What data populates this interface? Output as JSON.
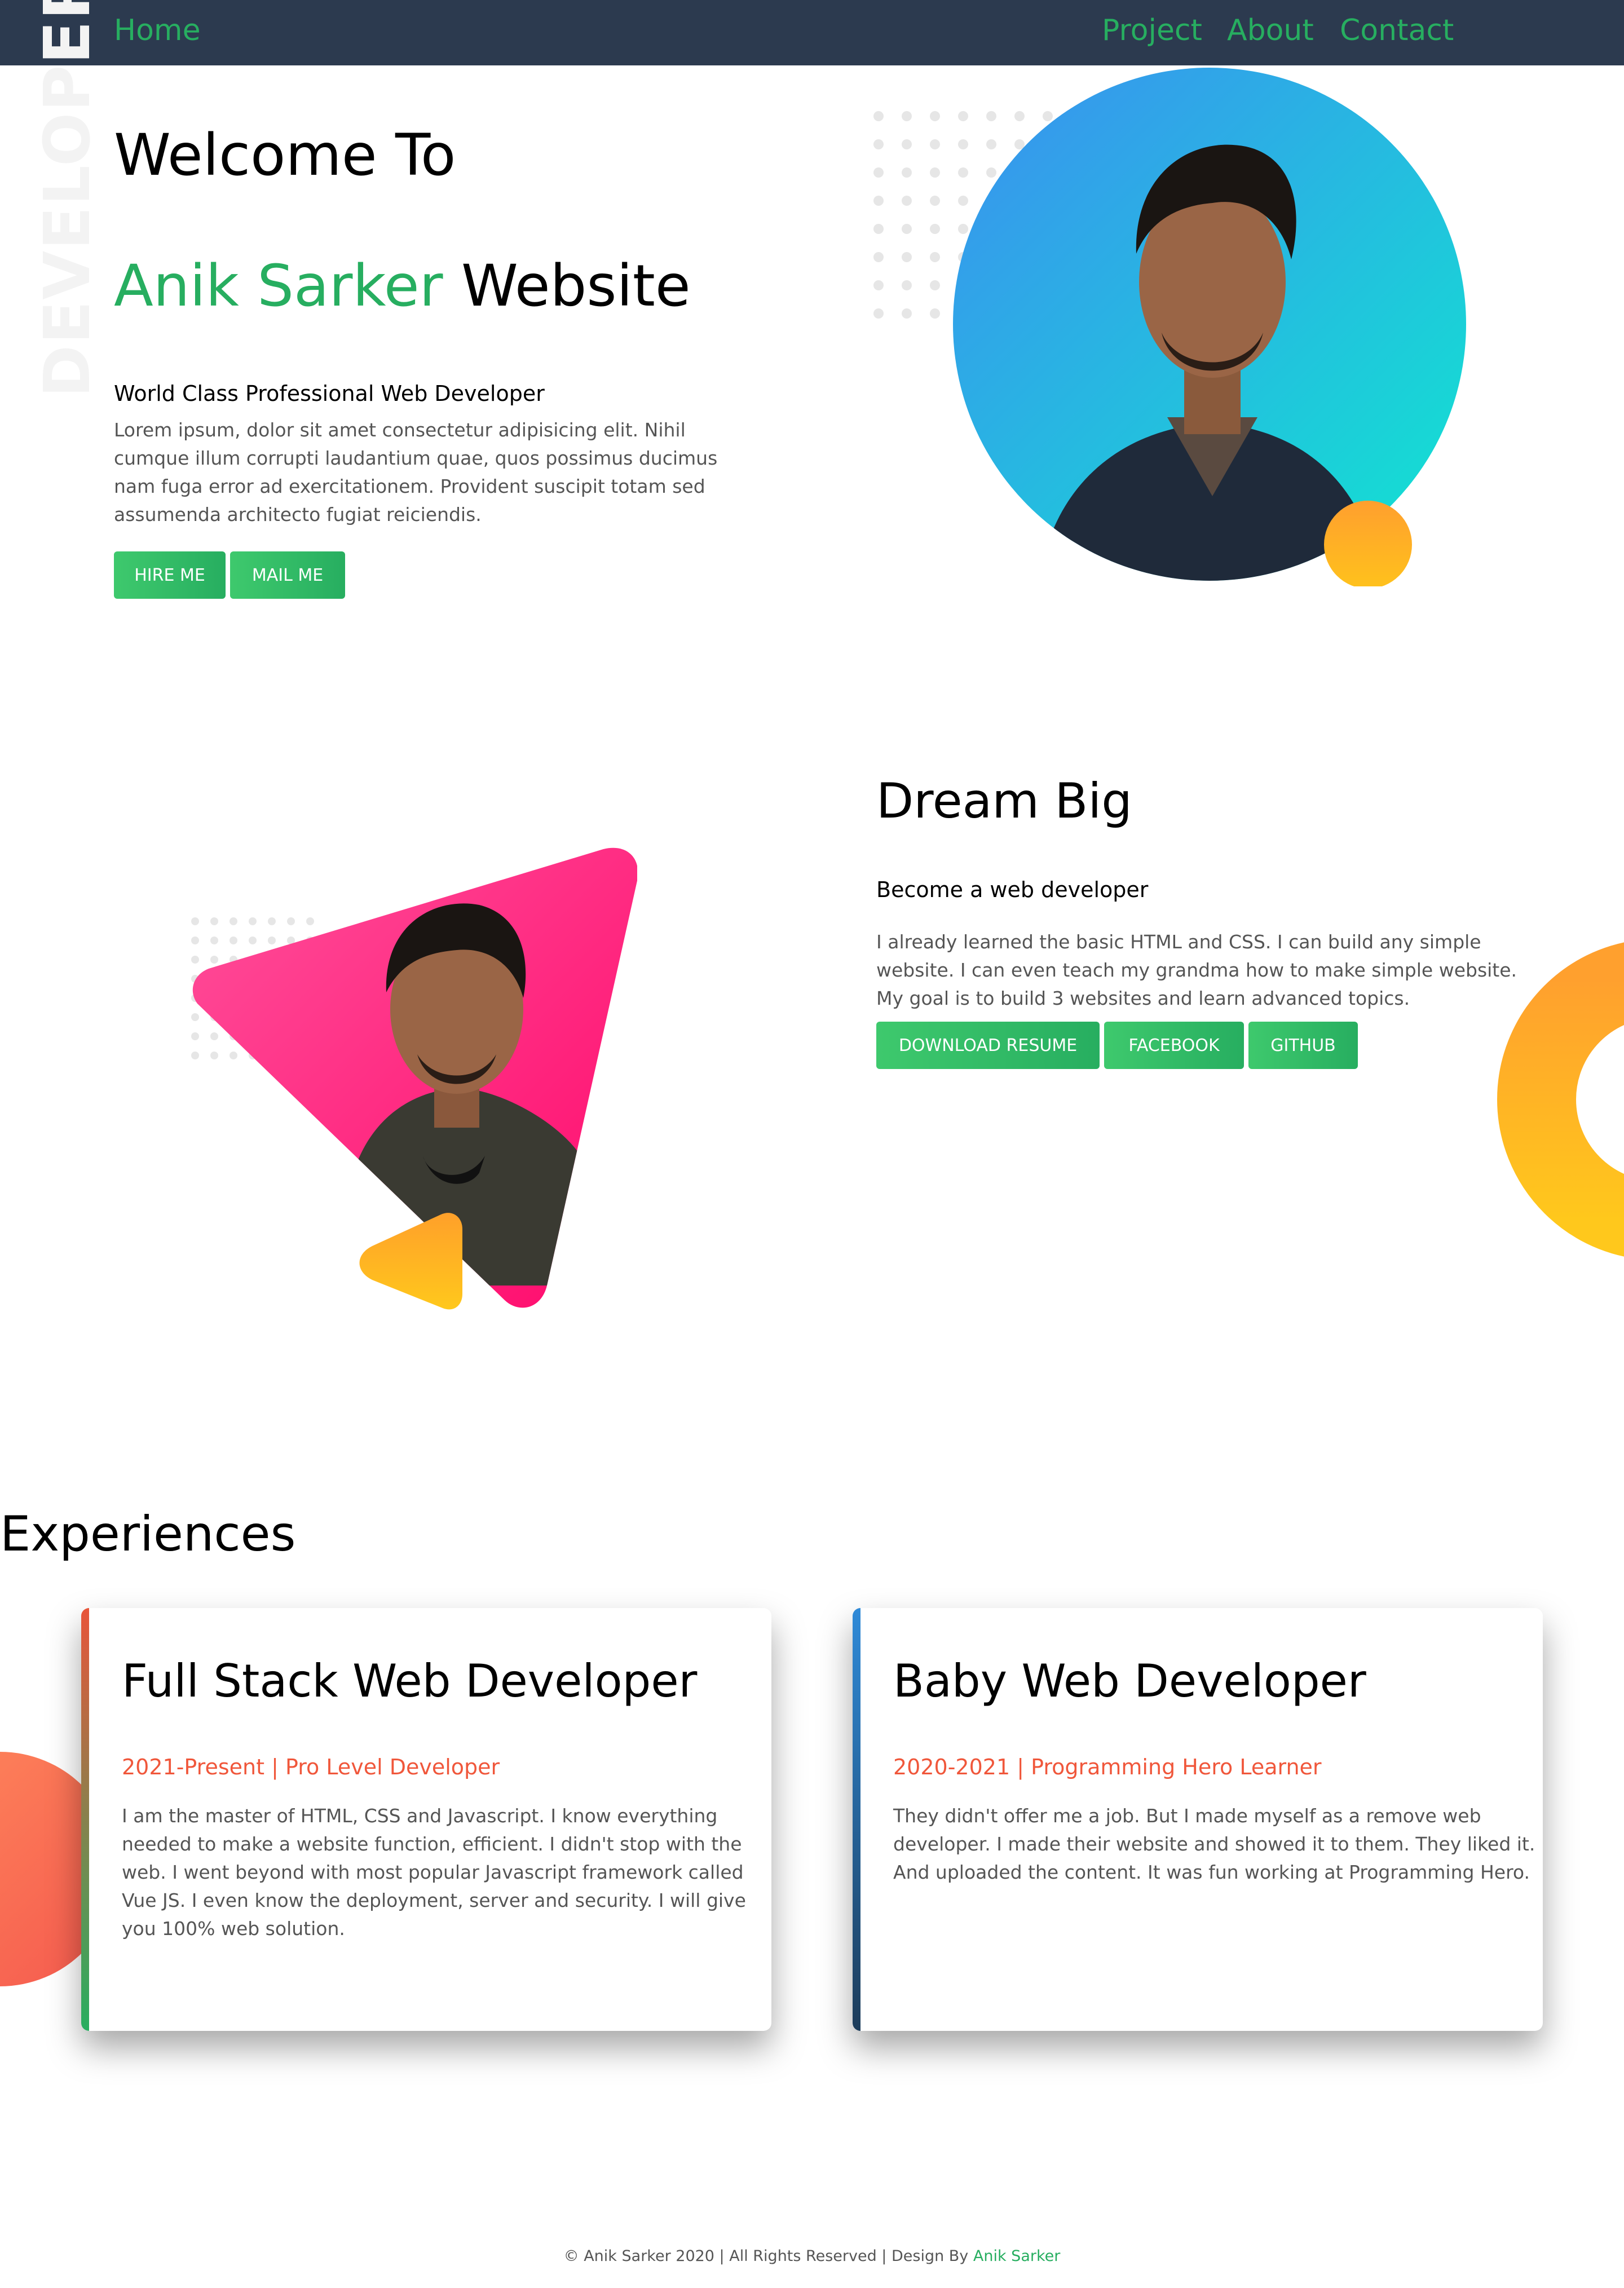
{
  "nav": {
    "home": "Home",
    "project": "Project",
    "about": "About",
    "contact": "Contact"
  },
  "hero": {
    "side_text": "DEVELOPER",
    "welcome": "Welcome To",
    "name": "Anik Sarker",
    "website": "Website",
    "subtitle": "World Class Professional Web Developer",
    "description": "Lorem ipsum, dolor sit amet consectetur adipisicing elit. Nihil cumque illum corrupti laudantium quae, quos possimus ducimus nam fuga error ad exercitationem. Provident suscipit totam sed assumenda architecto fugiat reiciendis.",
    "hire_label": "HIRE ME",
    "mail_label": "MAIL ME"
  },
  "dream": {
    "title": "Dream Big",
    "subtitle": "Become a web developer",
    "description": "I already learned the basic HTML and CSS. I can build any simple website. I can even teach my grandma how to make simple website. My goal is to build 3 websites and learn advanced topics.",
    "download_label": "DOWNLOAD RESUME",
    "facebook_label": "FACEBOOK",
    "github_label": "GITHUB"
  },
  "experiences": {
    "heading": "Experiences",
    "items": [
      {
        "title": "Full Stack Web Developer",
        "meta": "2021-Present | Pro Level Developer",
        "text": "I am the master of HTML, CSS and Javascript. I know everything needed to make a website function, efficient. I didn't stop with the web. I went beyond with most popular Javascript framework called Vue JS. I even know the deployment, server and security. I will give you 100% web solution."
      },
      {
        "title": "Baby Web Developer",
        "meta": "2020-2021 | Programming Hero Learner",
        "text": "They didn't offer me a job. But I made myself as a remove web developer. I made their website and showed it to them. They liked it. And uploaded the content. It was fun working at Programming Hero."
      }
    ]
  },
  "footer": {
    "text": "© Anik Sarker 2020 | All Rights Reserved | Design By",
    "author": "Anik Sarker"
  },
  "colors": {
    "nav_bg": "#2c3a4f",
    "accent_green": "#27ae60",
    "accent_orange": "#f0573b",
    "circle_gradient": [
      "#3b8ff0",
      "#10e6d0"
    ],
    "triangle_gradient": [
      "#ff4f9a",
      "#ff0a6c"
    ],
    "yellow": "#ffc21c"
  }
}
